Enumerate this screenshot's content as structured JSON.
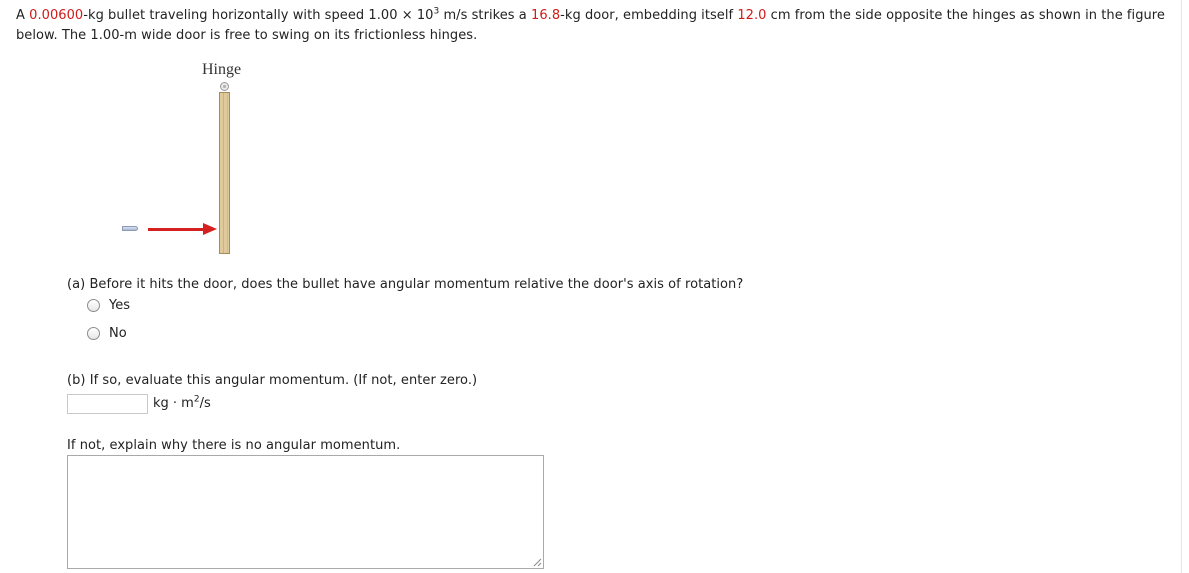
{
  "problem": {
    "t1": "A ",
    "bullet_mass": "0.00600",
    "t2": "-kg bullet traveling horizontally with speed 1.00 × 10",
    "exp": "3",
    "t3": " m/s strikes a ",
    "door_mass": "16.8",
    "t4": "-kg door, embedding itself ",
    "distance": "12.0",
    "t5": " cm from the side opposite the hinges as shown in the figure below. The 1.00-m wide door is free to swing on its frictionless hinges."
  },
  "figure": {
    "hinge_label": "Hinge",
    "arrow_color": "#d42020",
    "door_color": "#e0c99a"
  },
  "part_a": {
    "question": "(a) Before it hits the door, does the bullet have angular momentum relative the door's axis of rotation?",
    "options": [
      {
        "label": "Yes",
        "selected": false
      },
      {
        "label": "No",
        "selected": false
      }
    ]
  },
  "part_b": {
    "question": "(b) If so, evaluate this angular momentum. (If not, enter zero.)",
    "input_value": "",
    "unit_prefix": "kg · m",
    "unit_exp": "2",
    "unit_suffix": "/s",
    "explain_label": "If not, explain why there is no angular momentum.",
    "explain_value": ""
  },
  "colors": {
    "highlight": "#d11a1a"
  }
}
